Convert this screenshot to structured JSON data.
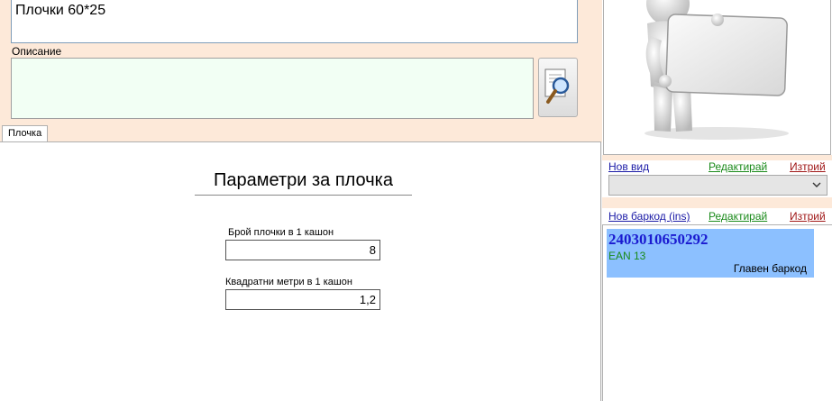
{
  "product": {
    "name_value": "Плочки 60*25",
    "description_label": "Описание",
    "description_value": ""
  },
  "tabs": [
    {
      "label": "Плочка"
    }
  ],
  "params": {
    "title": "Параметри за плочка",
    "tiles_per_box_label": "Брой плочки в 1 кашон",
    "tiles_per_box_value": "8",
    "sqm_per_box_label": "Квадратни метри в 1 кашон",
    "sqm_per_box_value": "1,2"
  },
  "view_links": {
    "new_label": "Нов вид",
    "edit_label": "Редактирай",
    "delete_label": "Изтрий"
  },
  "view_select": {
    "selected": ""
  },
  "barcode_links": {
    "new_label": "Нов баркод (ins)",
    "edit_label": "Редактирай",
    "delete_label": "Изтрий"
  },
  "barcodes": [
    {
      "code": "2403010650292",
      "type": "EAN 13",
      "note": "Главен баркод"
    }
  ],
  "colors": {
    "panel_bg": "#fde9d9",
    "desc_bg": "#f2fff4",
    "barcode_highlight": "#8cc0ff",
    "link_new": "#1a1aa6",
    "link_edit": "#1a8a1a",
    "link_delete": "#a01818"
  },
  "icons": {
    "search_button": "magnifier-document-icon",
    "image_placeholder": "person-holding-blank-sign-image",
    "dropdown": "chevron-down-icon"
  }
}
